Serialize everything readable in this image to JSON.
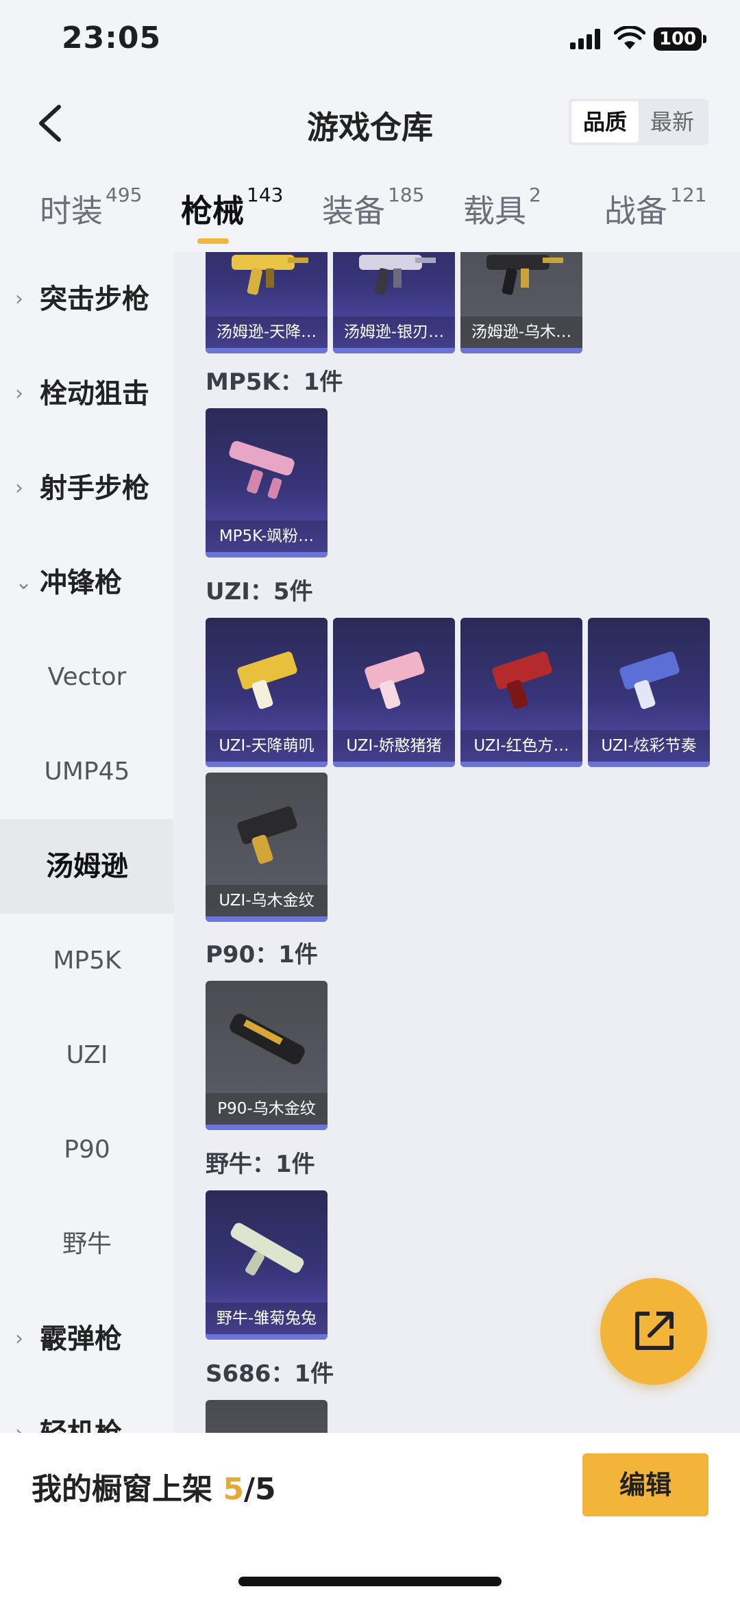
{
  "status": {
    "time": "23:05",
    "battery": "100"
  },
  "header": {
    "title": "游戏仓库",
    "sort": [
      "品质",
      "最新"
    ]
  },
  "tabs": [
    {
      "label": "时装",
      "count": "495"
    },
    {
      "label": "枪械",
      "count": "143"
    },
    {
      "label": "装备",
      "count": "185"
    },
    {
      "label": "载具",
      "count": "2"
    },
    {
      "label": "战备",
      "count": "121"
    }
  ],
  "sidebar": [
    {
      "label": "突击步枪",
      "arrow": "›"
    },
    {
      "label": "栓动狙击",
      "arrow": "›"
    },
    {
      "label": "射手步枪",
      "arrow": "›"
    },
    {
      "label": "冲锋枪",
      "arrow": "⌄"
    },
    {
      "label": "Vector"
    },
    {
      "label": "UMP45"
    },
    {
      "label": "汤姆逊"
    },
    {
      "label": "MP5K"
    },
    {
      "label": "UZI"
    },
    {
      "label": "P90"
    },
    {
      "label": "野牛"
    },
    {
      "label": "霰弹枪",
      "arrow": "›"
    },
    {
      "label": "轻机枪",
      "arrow": "›"
    }
  ],
  "groups": {
    "thompson": {
      "items": [
        "汤姆逊-天降…",
        "汤姆逊-银刃…",
        "汤姆逊-乌木…"
      ]
    },
    "mp5k": {
      "title": "MP5K：1件",
      "items": [
        "MP5K-飒粉…"
      ]
    },
    "uzi": {
      "title": "UZI：5件",
      "items": [
        "UZI-天降萌叽",
        "UZI-娇憨猪猪",
        "UZI-红色方…",
        "UZI-炫彩节奏",
        "UZI-乌木金纹"
      ]
    },
    "p90": {
      "title": "P90：1件",
      "items": [
        "P90-乌木金纹"
      ]
    },
    "bison": {
      "title": "野牛：1件",
      "items": [
        "野牛-雏菊兔兔"
      ]
    },
    "s686": {
      "title": "S686：1件"
    }
  },
  "bottom": {
    "shelf_label": "我的橱窗上架",
    "shelf_count": "5",
    "shelf_total": "/5",
    "edit_label": "编辑"
  },
  "colors": {
    "accent": "#f3b43a",
    "card_purple": "#38357a",
    "card_grey": "#55575e"
  }
}
